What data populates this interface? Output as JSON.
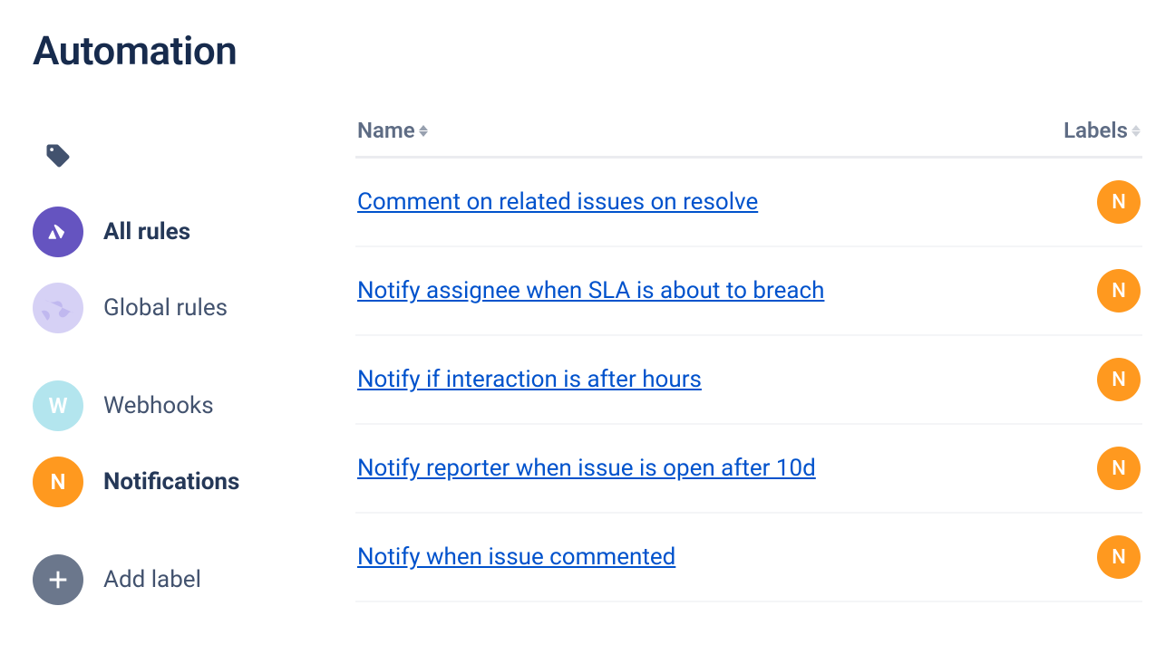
{
  "page_title": "Automation",
  "sidebar": {
    "items": [
      {
        "kind": "tag-icon"
      },
      {
        "kind": "entry",
        "icon": "atlassian",
        "color": "purple",
        "label": "All rules",
        "active": true
      },
      {
        "kind": "entry",
        "icon": "globe",
        "color": "lav",
        "label": "Global rules",
        "active": false
      },
      {
        "kind": "gap"
      },
      {
        "kind": "entry",
        "icon": "letter",
        "letter": "W",
        "color": "pale",
        "label": "Webhooks",
        "active": false
      },
      {
        "kind": "entry",
        "icon": "letter",
        "letter": "N",
        "color": "orange",
        "label": "Notifications",
        "active": true
      },
      {
        "kind": "gap"
      },
      {
        "kind": "entry",
        "icon": "plus",
        "color": "gray",
        "label": "Add label",
        "active": false
      }
    ]
  },
  "table": {
    "columns": {
      "name": "Name",
      "labels": "Labels"
    },
    "rows": [
      {
        "name": "Comment on related issues on resolve",
        "label_letter": "N"
      },
      {
        "name": "Notify assignee when SLA is about to breach",
        "label_letter": "N"
      },
      {
        "name": "Notify if interaction is after hours",
        "label_letter": "N"
      },
      {
        "name": "Notify reporter when issue is open after 10d",
        "label_letter": "N"
      },
      {
        "name": "Notify when issue commented",
        "label_letter": "N"
      }
    ]
  }
}
